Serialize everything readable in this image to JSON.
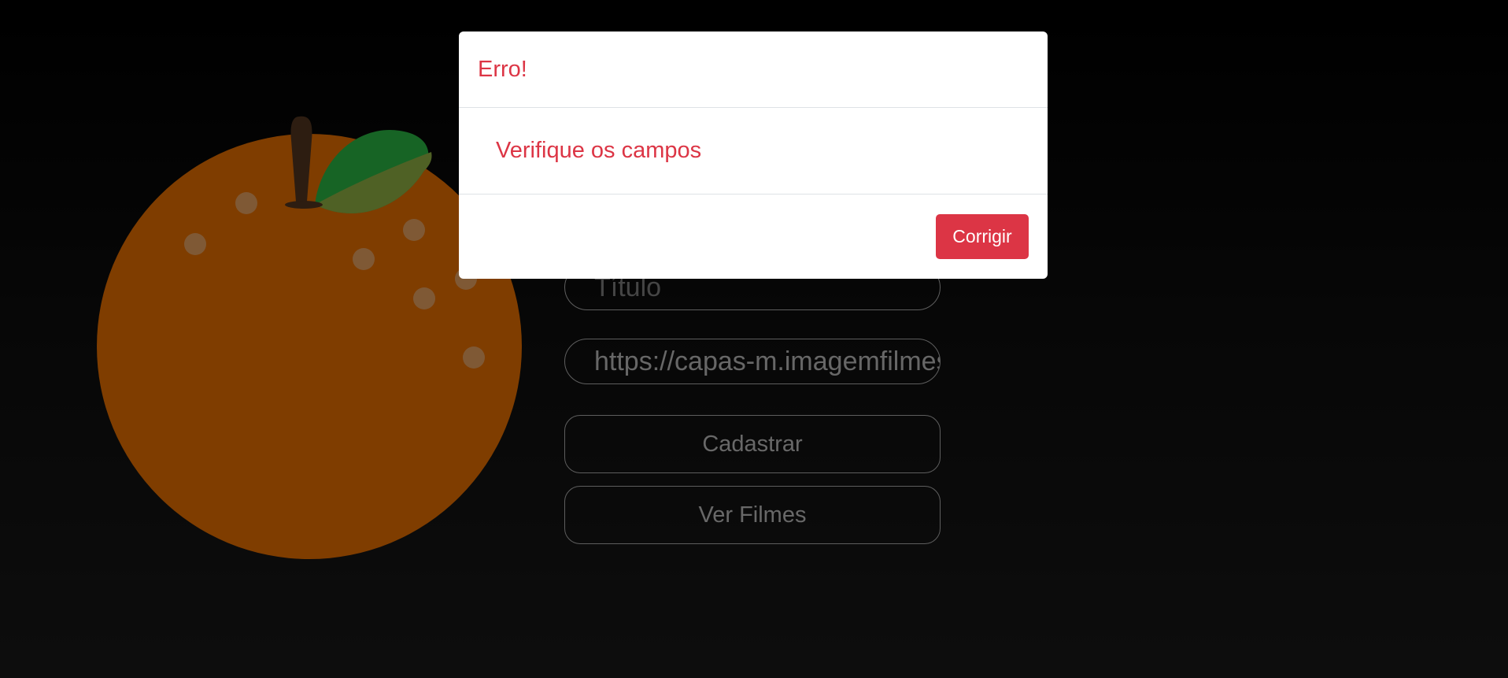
{
  "form": {
    "title_placeholder": "Título",
    "url_value": "https://capas-m.imagemfilmes.com.br",
    "submit_label": "Cadastrar",
    "view_movies_label": "Ver Filmes"
  },
  "illustration": {
    "icon": "orange-fruit-icon",
    "colors": {
      "fruit": "#ff7a00",
      "leaf": "#2fc84a",
      "leaf_highlight": "#9ec24a",
      "stem": "#5a3a22",
      "dots": "#ffb36b"
    }
  },
  "modal": {
    "title": "Erro!",
    "message": "Verifique os campos",
    "button_label": "Corrigir",
    "accent_color": "#dc3545"
  }
}
